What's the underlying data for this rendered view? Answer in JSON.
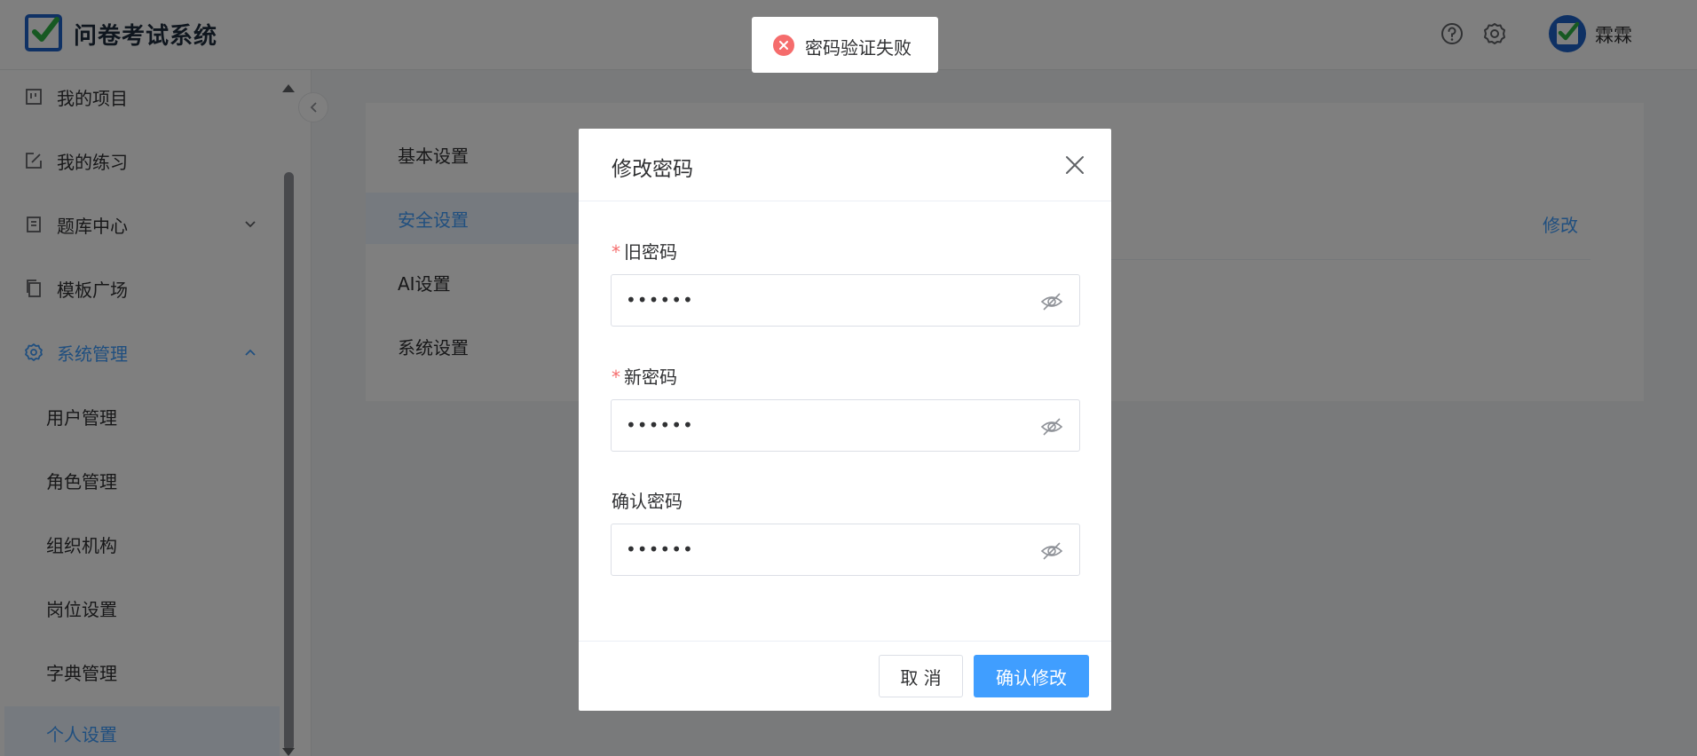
{
  "header": {
    "app_title": "问卷考试系统",
    "username": "霖霖"
  },
  "sidebar": {
    "items": [
      {
        "label": "我的项目",
        "icon": "project-icon"
      },
      {
        "label": "我的练习",
        "icon": "edit-icon"
      },
      {
        "label": "题库中心",
        "icon": "book-icon"
      },
      {
        "label": "模板广场",
        "icon": "copy-icon"
      },
      {
        "label": "系统管理",
        "icon": "gear-icon"
      }
    ],
    "sub_items": [
      {
        "label": "用户管理"
      },
      {
        "label": "角色管理"
      },
      {
        "label": "组织机构"
      },
      {
        "label": "岗位设置"
      },
      {
        "label": "字典管理"
      },
      {
        "label": "个人设置"
      }
    ]
  },
  "settings": {
    "tabs": [
      {
        "label": "基本设置"
      },
      {
        "label": "安全设置"
      },
      {
        "label": "AI设置"
      },
      {
        "label": "系统设置"
      }
    ],
    "edit_link": "修改"
  },
  "dialog": {
    "title": "修改密码",
    "fields": [
      {
        "label": "旧密码",
        "required": "*",
        "value": "••••••"
      },
      {
        "label": "新密码",
        "required": "*",
        "value": "••••••"
      },
      {
        "label": "确认密码",
        "value": "••••••"
      }
    ],
    "cancel_label": "取 消",
    "confirm_label": "确认修改"
  },
  "toast": {
    "message": "密码验证失败",
    "type": "error"
  },
  "colors": {
    "primary": "#409eff",
    "error": "#f56c6c",
    "logo_blue": "#1e62c9",
    "logo_green": "#2fb344"
  }
}
